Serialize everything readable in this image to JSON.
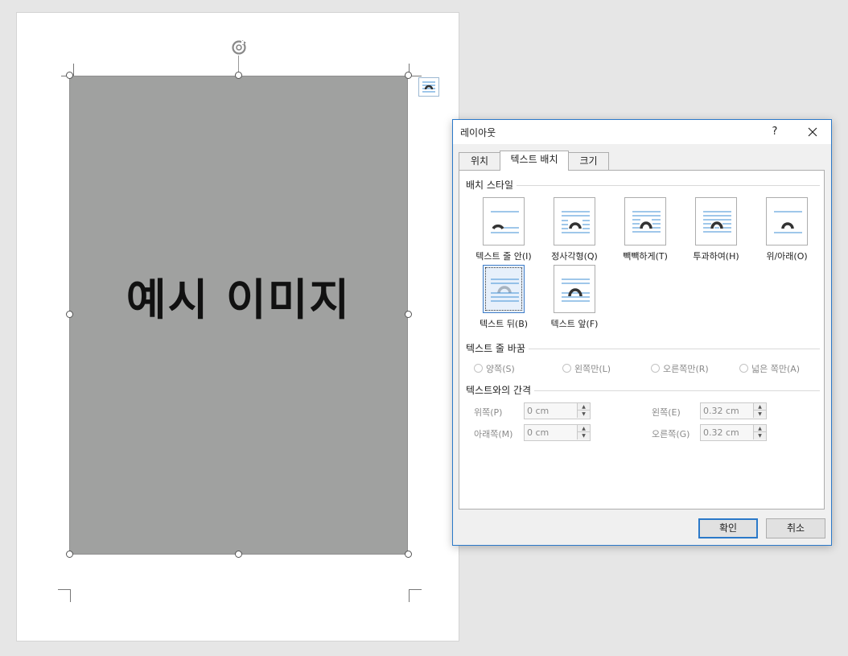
{
  "document": {
    "image_text": "예시 이미지"
  },
  "dialog": {
    "title": "레이아웃",
    "help": "?",
    "tabs": [
      {
        "label": "위치",
        "active": false
      },
      {
        "label": "텍스트 배치",
        "active": true
      },
      {
        "label": "크기",
        "active": false
      }
    ],
    "wrap_style": {
      "section_title": "배치 스타일",
      "options": [
        {
          "label": "텍스트 줄 안(I)",
          "icon": "wrap-inline-icon"
        },
        {
          "label": "정사각형(Q)",
          "icon": "wrap-square-icon"
        },
        {
          "label": "빽빽하게(T)",
          "icon": "wrap-tight-icon"
        },
        {
          "label": "투과하여(H)",
          "icon": "wrap-through-icon"
        },
        {
          "label": "위/아래(O)",
          "icon": "wrap-top-bottom-icon"
        },
        {
          "label": "텍스트 뒤(B)",
          "icon": "wrap-behind-text-icon",
          "selected": true
        },
        {
          "label": "텍스트 앞(F)",
          "icon": "wrap-in-front-icon"
        }
      ]
    },
    "wrap_text": {
      "section_title": "텍스트 줄 바꿈",
      "options": [
        "양쪽(S)",
        "왼쪽만(L)",
        "오른쪽만(R)",
        "넓은 쪽만(A)"
      ]
    },
    "distance": {
      "section_title": "텍스트와의 간격",
      "top_label": "위쪽(P)",
      "top_value": "0 cm",
      "bottom_label": "아래쪽(M)",
      "bottom_value": "0 cm",
      "left_label": "왼쪽(E)",
      "left_value": "0.32 cm",
      "right_label": "오른쪽(G)",
      "right_value": "0.32 cm"
    },
    "ok_label": "확인",
    "cancel_label": "취소"
  },
  "colors": {
    "accent": "#2b79c9",
    "line_blue": "#3f8fd6",
    "image_fill": "#a0a1a0"
  }
}
